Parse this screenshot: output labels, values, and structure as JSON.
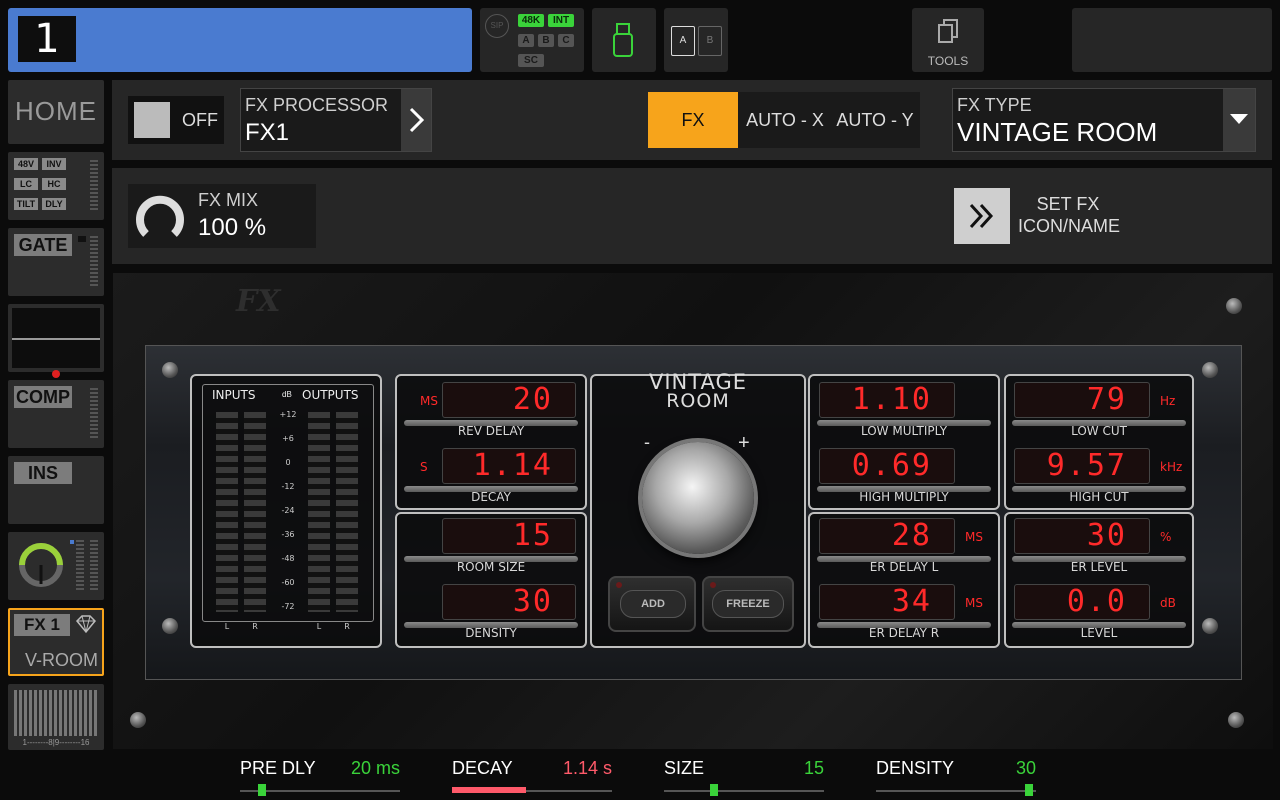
{
  "channel": {
    "number": "1"
  },
  "topbar": {
    "sip": "SIP",
    "rate": "48K",
    "clock": "INT",
    "buses": [
      "A",
      "B",
      "C"
    ],
    "sc": "SC",
    "ab": [
      "A",
      "B"
    ],
    "tools": "TOOLS"
  },
  "sidebar": {
    "home": "HOME",
    "pre_tags": [
      "48V",
      "INV",
      "LC",
      "HC",
      "TILT",
      "DLY"
    ],
    "gate": "GATE",
    "comp": "COMP",
    "ins": "INS",
    "fx_tag": "FX 1",
    "fx_name": "V-ROOM",
    "meter_scale": "1--------8|9--------16"
  },
  "header": {
    "toggle": "OFF",
    "fx_processor_label": "FX PROCESSOR",
    "fx_processor_value": "FX1",
    "tabs": [
      "FX",
      "AUTO - X",
      "AUTO - Y"
    ],
    "fx_type_label": "FX TYPE",
    "fx_type_value": "VINTAGE ROOM"
  },
  "mix": {
    "label": "FX MIX",
    "value": "100 %",
    "set_fx_line1": "SET FX",
    "set_fx_line2": "ICON/NAME"
  },
  "rack": {
    "logo": "FX",
    "title_line1": "VINTAGE",
    "title_line2": "ROOM",
    "io": {
      "inputs": "INPUTS",
      "db": "dB",
      "outputs": "OUTPUTS",
      "scale": [
        "+12",
        "+6",
        "0",
        "-12",
        "-24",
        "-36",
        "-48",
        "-60",
        "-72"
      ],
      "lr": [
        "L",
        "R",
        "L",
        "R"
      ]
    },
    "params_left": [
      {
        "name": "REV DELAY",
        "value": "20",
        "unit": "MS"
      },
      {
        "name": "DECAY",
        "value": "1.14",
        "unit": "S"
      },
      {
        "name": "ROOM SIZE",
        "value": "15",
        "unit": ""
      },
      {
        "name": "DENSITY",
        "value": "30",
        "unit": ""
      }
    ],
    "params_mid": [
      {
        "name": "LOW MULTIPLY",
        "value": "1.10",
        "unit": ""
      },
      {
        "name": "HIGH MULTIPLY",
        "value": "0.69",
        "unit": ""
      },
      {
        "name": "ER DELAY L",
        "value": "28",
        "unit": "MS"
      },
      {
        "name": "ER DELAY R",
        "value": "34",
        "unit": "MS"
      }
    ],
    "params_right": [
      {
        "name": "LOW CUT",
        "value": "79",
        "unit": "Hz"
      },
      {
        "name": "HIGH CUT",
        "value": "9.57",
        "unit": "kHz"
      },
      {
        "name": "ER LEVEL",
        "value": "30",
        "unit": "%"
      },
      {
        "name": "LEVEL",
        "value": "0.0",
        "unit": "dB"
      }
    ],
    "knob_minus": "-",
    "knob_plus": "+",
    "btn_add": "ADD",
    "btn_freeze": "FREEZE"
  },
  "bottom": [
    {
      "label": "PRE DLY",
      "value": "20 ms",
      "color": "#3ad33a",
      "fraction": 0.12
    },
    {
      "label": "DECAY",
      "value": "1.14 s",
      "color": "#ff5a6a",
      "fraction": 0.46
    },
    {
      "label": "SIZE",
      "value": "15",
      "color": "#3ad33a",
      "fraction": 0.3
    },
    {
      "label": "DENSITY",
      "value": "30",
      "color": "#3ad33a",
      "fraction": 0.98
    }
  ],
  "colors": {
    "accent": "#f7a41b",
    "channel": "#4a7bd0",
    "lcd": "#ff2a2a",
    "green": "#3ad33a"
  }
}
